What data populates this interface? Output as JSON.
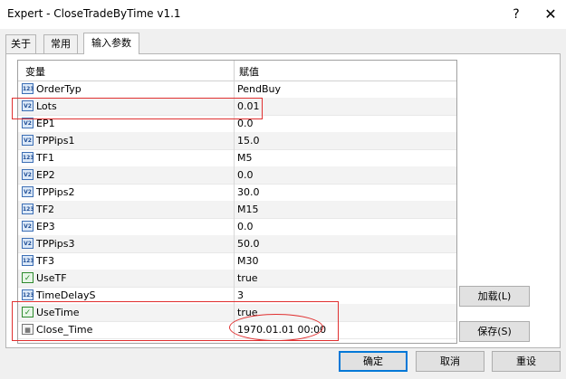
{
  "window": {
    "title": "Expert - CloseTradeByTime v1.1",
    "help_glyph": "?",
    "close_glyph": "✕"
  },
  "tabs": [
    {
      "label": "关于",
      "active": false
    },
    {
      "label": "常用",
      "active": false
    },
    {
      "label": "输入参数",
      "active": true
    }
  ],
  "grid": {
    "col_variable": "变量",
    "col_value": "赋值",
    "rows": [
      {
        "name": "OrderTyp",
        "value": "PendBuy",
        "icon": "int-icon"
      },
      {
        "name": "Lots",
        "value": "0.01",
        "icon": "double-icon"
      },
      {
        "name": "EP1",
        "value": "0.0",
        "icon": "double-icon"
      },
      {
        "name": "TPPips1",
        "value": "15.0",
        "icon": "double-icon"
      },
      {
        "name": "TF1",
        "value": "M5",
        "icon": "int-icon"
      },
      {
        "name": "EP2",
        "value": "0.0",
        "icon": "double-icon"
      },
      {
        "name": "TPPips2",
        "value": "30.0",
        "icon": "double-icon"
      },
      {
        "name": "TF2",
        "value": "M15",
        "icon": "int-icon"
      },
      {
        "name": "EP3",
        "value": "0.0",
        "icon": "double-icon"
      },
      {
        "name": "TPPips3",
        "value": "50.0",
        "icon": "double-icon"
      },
      {
        "name": "TF3",
        "value": "M30",
        "icon": "int-icon"
      },
      {
        "name": "UseTF",
        "value": "true",
        "icon": "bool-icon"
      },
      {
        "name": "TimeDelayS",
        "value": "3",
        "icon": "int-icon"
      },
      {
        "name": "UseTime",
        "value": "true",
        "icon": "bool-icon"
      },
      {
        "name": "Close_Time",
        "value": "1970.01.01 00:00",
        "icon": "datetime-icon"
      }
    ]
  },
  "side_buttons": {
    "load": "加载(L)",
    "save": "保存(S)"
  },
  "footer_buttons": {
    "ok": "确定",
    "cancel": "取消",
    "reset": "重设"
  },
  "annotation_color": "#e03030"
}
